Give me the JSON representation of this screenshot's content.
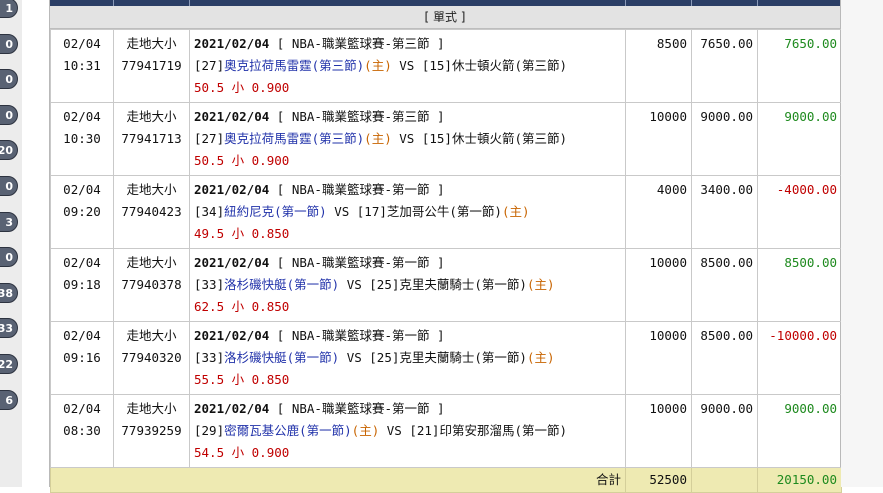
{
  "left_pills": [
    "1",
    "0",
    "0",
    "0",
    "20",
    "0",
    "3",
    "0",
    "38",
    "33",
    "22",
    "6"
  ],
  "type_header": "[ 單式 ]",
  "rows": [
    {
      "date": "02/04",
      "time": "10:31",
      "bet_type": "走地大小",
      "ticket": "77941719",
      "match_date": "2021/02/04",
      "league": "[ NBA-職業籃球賽-第三節 ]",
      "home_code": "[27]",
      "home_name": "奧克拉荷馬雷霆(第三節)",
      "home_mark": "(主)",
      "vs": " VS ",
      "away_code": "[15]",
      "away_name": "休士頓火箭(第三節)",
      "away_mark": "",
      "pick": "50.5 小 0.900",
      "stake": "8500",
      "valid": "7650.00",
      "result": "7650.00",
      "result_color": "green"
    },
    {
      "date": "02/04",
      "time": "10:30",
      "bet_type": "走地大小",
      "ticket": "77941713",
      "match_date": "2021/02/04",
      "league": "[ NBA-職業籃球賽-第三節 ]",
      "home_code": "[27]",
      "home_name": "奧克拉荷馬雷霆(第三節)",
      "home_mark": "(主)",
      "vs": " VS ",
      "away_code": "[15]",
      "away_name": "休士頓火箭(第三節)",
      "away_mark": "",
      "pick": "50.5 小 0.900",
      "stake": "10000",
      "valid": "9000.00",
      "result": "9000.00",
      "result_color": "green"
    },
    {
      "date": "02/04",
      "time": "09:20",
      "bet_type": "走地大小",
      "ticket": "77940423",
      "match_date": "2021/02/04",
      "league": "[ NBA-職業籃球賽-第一節 ]",
      "home_code": "[34]",
      "home_name": "紐約尼克(第一節)",
      "home_mark": "",
      "vs": " VS ",
      "away_code": "[17]",
      "away_name": "芝加哥公牛(第一節)",
      "away_mark": "(主)",
      "pick": "49.5 小 0.850",
      "stake": "4000",
      "valid": "3400.00",
      "result": "-4000.00",
      "result_color": "red"
    },
    {
      "date": "02/04",
      "time": "09:18",
      "bet_type": "走地大小",
      "ticket": "77940378",
      "match_date": "2021/02/04",
      "league": "[ NBA-職業籃球賽-第一節 ]",
      "home_code": "[33]",
      "home_name": "洛杉磯快艇(第一節)",
      "home_mark": "",
      "vs": " VS ",
      "away_code": "[25]",
      "away_name": "克里夫蘭騎士(第一節)",
      "away_mark": "(主)",
      "pick": "62.5 小 0.850",
      "stake": "10000",
      "valid": "8500.00",
      "result": "8500.00",
      "result_color": "green"
    },
    {
      "date": "02/04",
      "time": "09:16",
      "bet_type": "走地大小",
      "ticket": "77940320",
      "match_date": "2021/02/04",
      "league": "[ NBA-職業籃球賽-第一節 ]",
      "home_code": "[33]",
      "home_name": "洛杉磯快艇(第一節)",
      "home_mark": "",
      "vs": " VS ",
      "away_code": "[25]",
      "away_name": "克里夫蘭騎士(第一節)",
      "away_mark": "(主)",
      "pick": "55.5 小 0.850",
      "stake": "10000",
      "valid": "8500.00",
      "result": "-10000.00",
      "result_color": "red"
    },
    {
      "date": "02/04",
      "time": "08:30",
      "bet_type": "走地大小",
      "ticket": "77939259",
      "match_date": "2021/02/04",
      "league": "[ NBA-職業籃球賽-第一節 ]",
      "home_code": "[29]",
      "home_name": "密爾瓦基公鹿(第一節)",
      "home_mark": "(主)",
      "vs": " VS ",
      "away_code": "[21]",
      "away_name": "印第安那溜馬(第一節)",
      "away_mark": "",
      "pick": "54.5 小 0.900",
      "stake": "10000",
      "valid": "9000.00",
      "result": "9000.00",
      "result_color": "green"
    }
  ],
  "total": {
    "label": "合計",
    "stake": "52500",
    "result": "20150.00"
  },
  "colors": {
    "header": "#2b3f66",
    "team": "#2233aa",
    "home_mark": "#c86400",
    "pick": "#c00000",
    "win": "#1e8a1e",
    "loss": "#c00000",
    "total_bg": "#eeeab2"
  }
}
